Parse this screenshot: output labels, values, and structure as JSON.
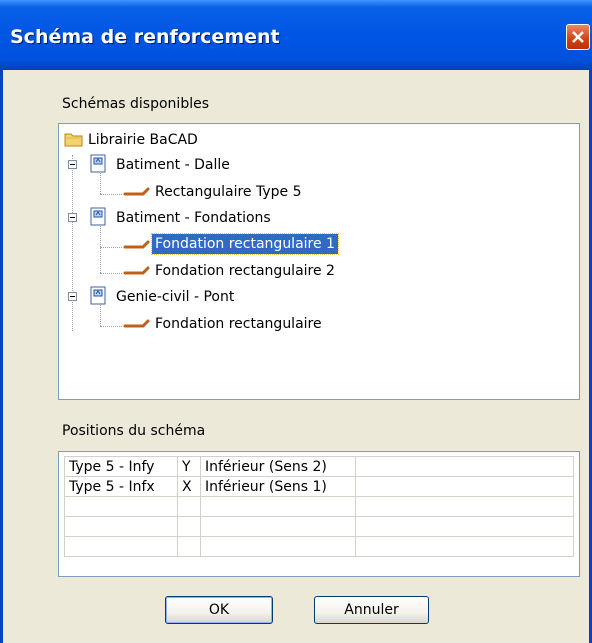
{
  "dialog": {
    "title": "Schéma de renforcement"
  },
  "tree": {
    "label": "Schémas disponibles",
    "root": "Librairie BaCAD",
    "groups": [
      {
        "label": "Batiment - Dalle",
        "children": [
          "Rectangulaire Type 5"
        ]
      },
      {
        "label": "Batiment - Fondations",
        "children": [
          "Fondation rectangulaire 1",
          "Fondation rectangulaire 2"
        ]
      },
      {
        "label": "Genie-civil - Pont",
        "children": [
          "Fondation rectangulaire"
        ]
      }
    ],
    "selected": "Fondation rectangulaire 1"
  },
  "positions": {
    "label": "Positions du schéma",
    "rows": [
      [
        "Type 5 - Infy",
        "Y",
        "Inférieur (Sens 2)",
        ""
      ],
      [
        "Type 5 - Infx",
        "X",
        "Inférieur (Sens 1)",
        ""
      ],
      [
        "",
        "",
        "",
        ""
      ],
      [
        "",
        "",
        "",
        ""
      ],
      [
        "",
        "",
        "",
        ""
      ]
    ]
  },
  "buttons": {
    "ok": "OK",
    "cancel": "Annuler"
  },
  "colors": {
    "title_bar": "#0052DD",
    "selection": "#316AC5",
    "close": "#D4410E"
  }
}
